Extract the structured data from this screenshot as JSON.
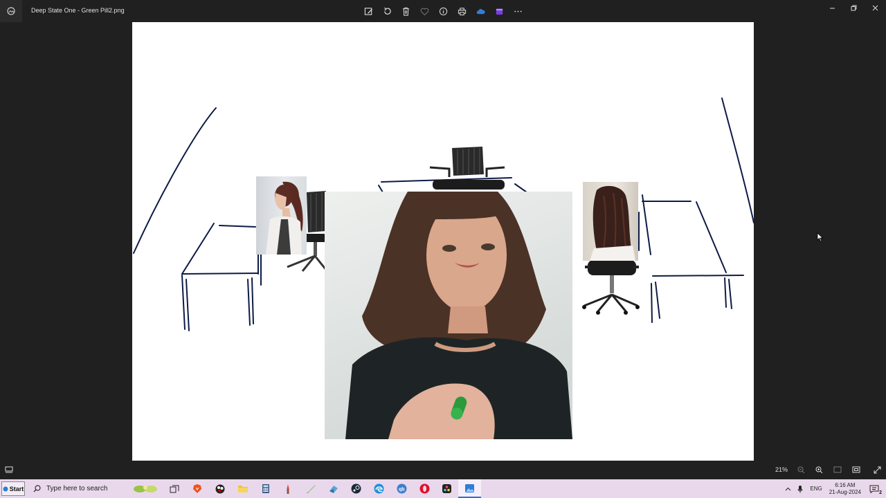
{
  "window": {
    "title": "Deep State One - Green Pill2.png",
    "toolbar": [
      "edit-image",
      "rotate",
      "delete",
      "favorite",
      "file-info",
      "print",
      "onedrive",
      "clipchamp",
      "more"
    ]
  },
  "status": {
    "zoom": "21%"
  },
  "taskbar": {
    "start_label": "Start",
    "search_placeholder": "Type here to search",
    "language": "ENG",
    "time": "6:16 AM",
    "date": "21-Aug-2024",
    "notification_count": "2",
    "apps": [
      "task-view",
      "brave",
      "obs",
      "file-explorer",
      "calculator",
      "paint",
      "notepad",
      "app",
      "steam",
      "edge",
      "qbittorrent",
      "opera",
      "davinci-resolve",
      "photos"
    ]
  },
  "colors": {
    "chrome": "#202020",
    "canvas": "#ffffff",
    "ink": "#0c1a45",
    "taskbar": "#e9d8ec",
    "pill": "#2a9a3c"
  }
}
